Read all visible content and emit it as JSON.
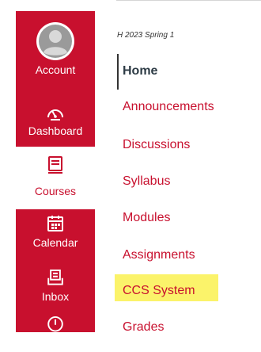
{
  "global_nav": {
    "items": [
      {
        "label": "Account",
        "icon": "account-avatar-icon"
      },
      {
        "label": "Dashboard",
        "icon": "dashboard-gauge-icon"
      },
      {
        "label": "Courses",
        "icon": "courses-book-icon"
      },
      {
        "label": "Calendar",
        "icon": "calendar-icon"
      },
      {
        "label": "Inbox",
        "icon": "inbox-icon"
      },
      {
        "label": "",
        "icon": "history-clock-icon"
      }
    ],
    "colors": {
      "brand": "#c8102e",
      "active_bg": "#ffffff"
    }
  },
  "course": {
    "term": "H 2023 Spring 1"
  },
  "course_nav": {
    "items": [
      {
        "label": "Home",
        "state": "active"
      },
      {
        "label": "Announcements"
      },
      {
        "label": "Discussions"
      },
      {
        "label": "Syllabus"
      },
      {
        "label": "Modules"
      },
      {
        "label": "Assignments"
      },
      {
        "label": "CCS System",
        "highlighted": true
      },
      {
        "label": "Grades"
      }
    ],
    "colors": {
      "link": "#c8102e",
      "active": "#2d3b45",
      "highlight": "#fbf36a"
    }
  }
}
